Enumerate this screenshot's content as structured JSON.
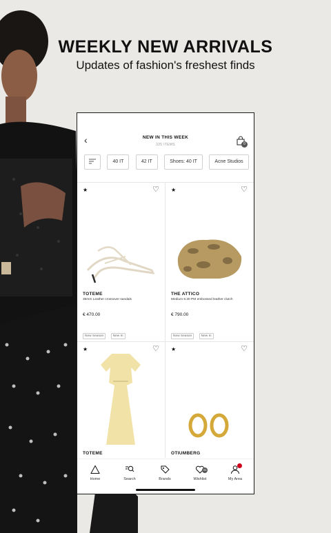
{
  "promo": {
    "headline": "WEEKLY NEW ARRIVALS",
    "subhead": "Updates of fashion's freshest finds"
  },
  "app": {
    "title": "NEW IN THIS WEEK",
    "subtitle": "325 ITEMS",
    "bag_count": "0",
    "filters": [
      "40 IT",
      "42 IT",
      "Shoes: 40 IT",
      "Acne Studios"
    ],
    "products": [
      {
        "brand": "TOTEME",
        "description": "35mm Leather crossover sandals",
        "price": "€ 470.00",
        "tags": [
          "New Season",
          "New In"
        ]
      },
      {
        "brand": "THE ATTICO",
        "description": "Medium 8.30 PM embossed leather clutch",
        "price": "€ 790.00",
        "tags": [
          "New Season",
          "New In"
        ]
      },
      {
        "brand": "TOTEME",
        "description": "",
        "price": "",
        "tags": []
      },
      {
        "brand": "OTIUMBERG",
        "description": "",
        "price": "",
        "tags": []
      }
    ],
    "nav": [
      {
        "label": "Home",
        "icon": "home-triangle-icon"
      },
      {
        "label": "Search",
        "icon": "search-icon"
      },
      {
        "label": "Brands",
        "icon": "tag-icon"
      },
      {
        "label": "Wishlist",
        "icon": "heart-icon",
        "badge": "41"
      },
      {
        "label": "My Area",
        "icon": "person-icon"
      }
    ]
  },
  "colors": {
    "background": "#ebe9e6",
    "accent_dot": "#d0021b"
  }
}
